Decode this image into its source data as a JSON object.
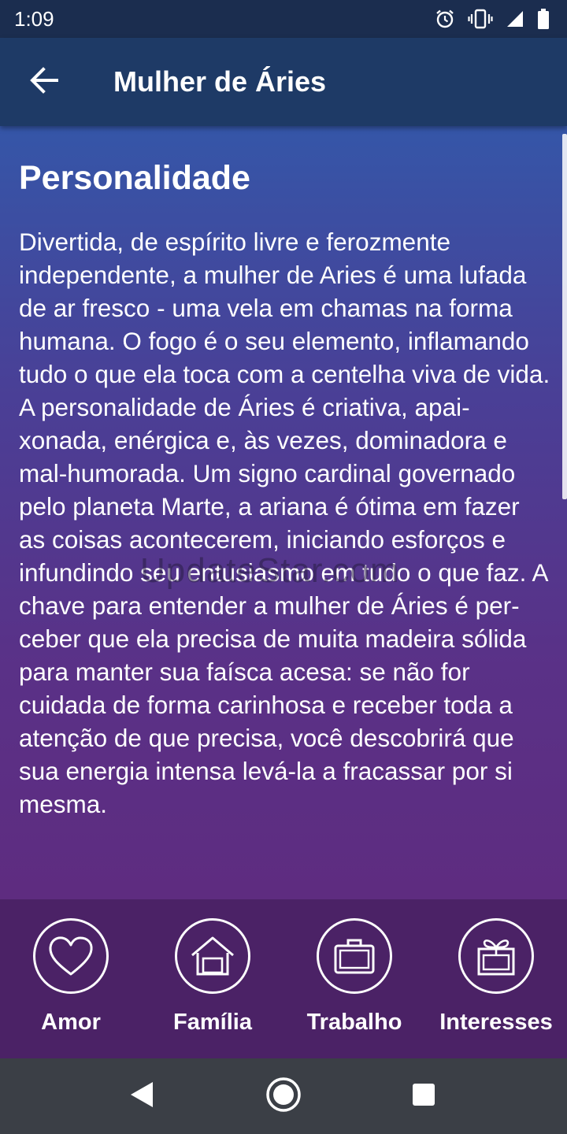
{
  "status_bar": {
    "time": "1:09",
    "icons": [
      "alarm-icon",
      "vibrate-icon",
      "signal-icon",
      "battery-icon"
    ]
  },
  "app_bar": {
    "title": "Mulher de Áries",
    "back_icon": "arrow-left-icon"
  },
  "content": {
    "heading": "Personalidade",
    "paragraphs": [
      "Divertida, de espírito livre e ferozmente independente, a mulher de Aries é uma lufada de ar fresco - uma vela em chamas na forma humana. O fogo é o seu elemento, inflamando tudo o que ela toca com a centelha viva de vida.",
      "A personalidade de Áries é criativa, apai-xonada, enérgica e, às vezes, dominadora e mal-humorada. Um signo cardinal governado pelo planeta Marte, a ariana é ótima em fazer as coisas acontecerem, iniciando esforços e infundindo seu entusiasmo em tudo o que faz. A chave para entender a mulher de Áries é per-ceber que ela precisa de muita madeira sólida para manter sua faísca acesa: se não for cuidada de forma carinhosa e receber toda a atenção de que precisa, você descobrirá que sua energia intensa levá-la a fracassar por si mesma."
    ],
    "watermark": "UpdateStar.com"
  },
  "bottom_menu": {
    "items": [
      {
        "label": "Amor",
        "icon": "heart-icon"
      },
      {
        "label": "Família",
        "icon": "house-icon"
      },
      {
        "label": "Trabalho",
        "icon": "briefcase-icon"
      },
      {
        "label": "Interesses",
        "icon": "gift-icon"
      }
    ]
  },
  "nav_bar": {
    "buttons": [
      "back-triangle-icon",
      "home-circle-icon",
      "recents-square-icon"
    ]
  },
  "colors": {
    "status_bar": "#1b2d4f",
    "app_bar": "#1e3a66",
    "content_top": "#3556a8",
    "content_bottom": "#5e2c80",
    "bottom_menu": "#4b2266",
    "nav_bar": "#3b3f46"
  }
}
